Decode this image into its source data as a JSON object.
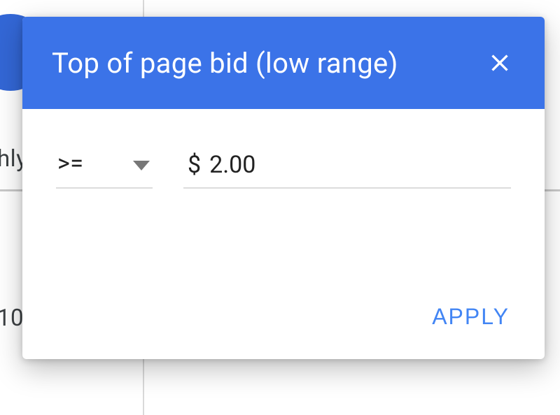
{
  "background": {
    "fragment_left": "hly",
    "fragment_number": "10"
  },
  "dialog": {
    "title": "Top of page bid (low range)",
    "operator": {
      "selected": ">="
    },
    "value": {
      "currency_symbol": "$",
      "amount": "2.00"
    },
    "apply_label": "APPLY"
  }
}
